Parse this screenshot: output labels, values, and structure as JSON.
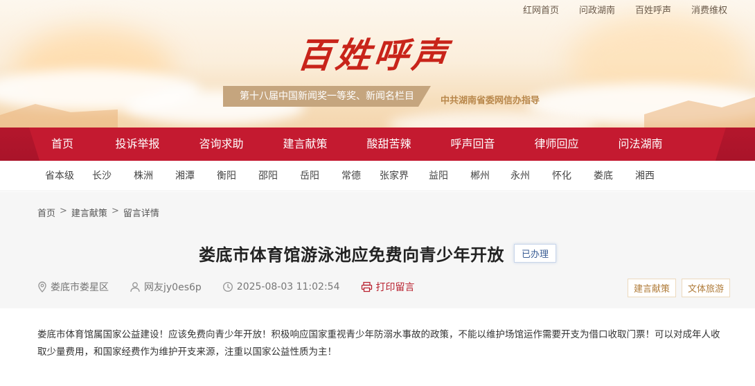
{
  "top_links": [
    "红网首页",
    "问政湖南",
    "百姓呼声",
    "消费维权"
  ],
  "logo_text": "百姓呼声",
  "award_text": "第十八届中国新闻奖一等奖、新闻名栏目",
  "guide_text": "中共湖南省委网信办指导",
  "nav": [
    "首页",
    "投诉举报",
    "咨询求助",
    "建言献策",
    "酸甜苦辣",
    "呼声回音",
    "律师回应",
    "问法湖南"
  ],
  "regions": [
    "省本级",
    "长沙",
    "株洲",
    "湘潭",
    "衡阳",
    "邵阳",
    "岳阳",
    "常德",
    "张家界",
    "益阳",
    "郴州",
    "永州",
    "怀化",
    "娄底",
    "湘西"
  ],
  "breadcrumb": [
    "首页",
    "建言献策",
    "留言详情"
  ],
  "breadcrumb_sep": ">",
  "article": {
    "title": "娄底市体育馆游泳池应免费向青少年开放",
    "status": "已办理",
    "location": "娄底市娄星区",
    "author": "网友jy0es6p",
    "datetime": "2025-08-03 11:02:54",
    "print_label": "打印留言",
    "tags": [
      "建言献策",
      "文体旅游"
    ],
    "body": "娄底市体育馆属国家公益建设！应该免费向青少年开放！积极响应国家重视青少年防溺水事故的政策，不能以维护场馆运作需要开支为借口收取门票！可以对成年人收取少量费用，和国家经费作为维护开支来源，注重以国家公益性质为主！"
  },
  "colors": {
    "nav_red": "#c41a30",
    "brand_red": "#c8241a",
    "award_gold": "#c5a57e"
  }
}
